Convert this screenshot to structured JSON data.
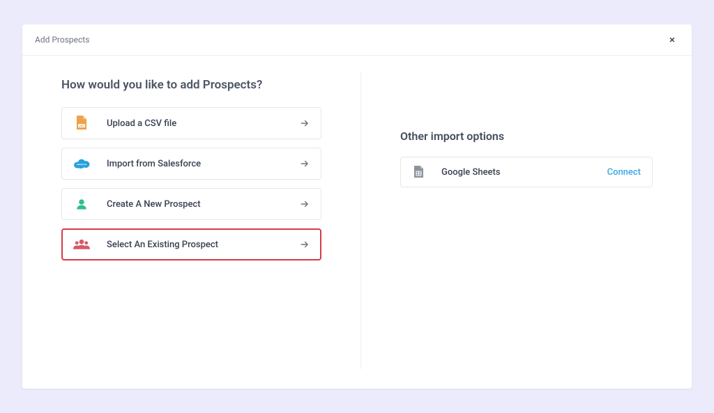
{
  "modal": {
    "title": "Add Prospects",
    "close": "×"
  },
  "left": {
    "heading": "How would you like to add Prospects?",
    "options": [
      {
        "label": "Upload a CSV file"
      },
      {
        "label": "Import from Salesforce"
      },
      {
        "label": "Create A New Prospect"
      },
      {
        "label": "Select An Existing Prospect"
      }
    ]
  },
  "right": {
    "heading": "Other import options",
    "google_sheets_label": "Google Sheets",
    "connect_label": "Connect"
  }
}
